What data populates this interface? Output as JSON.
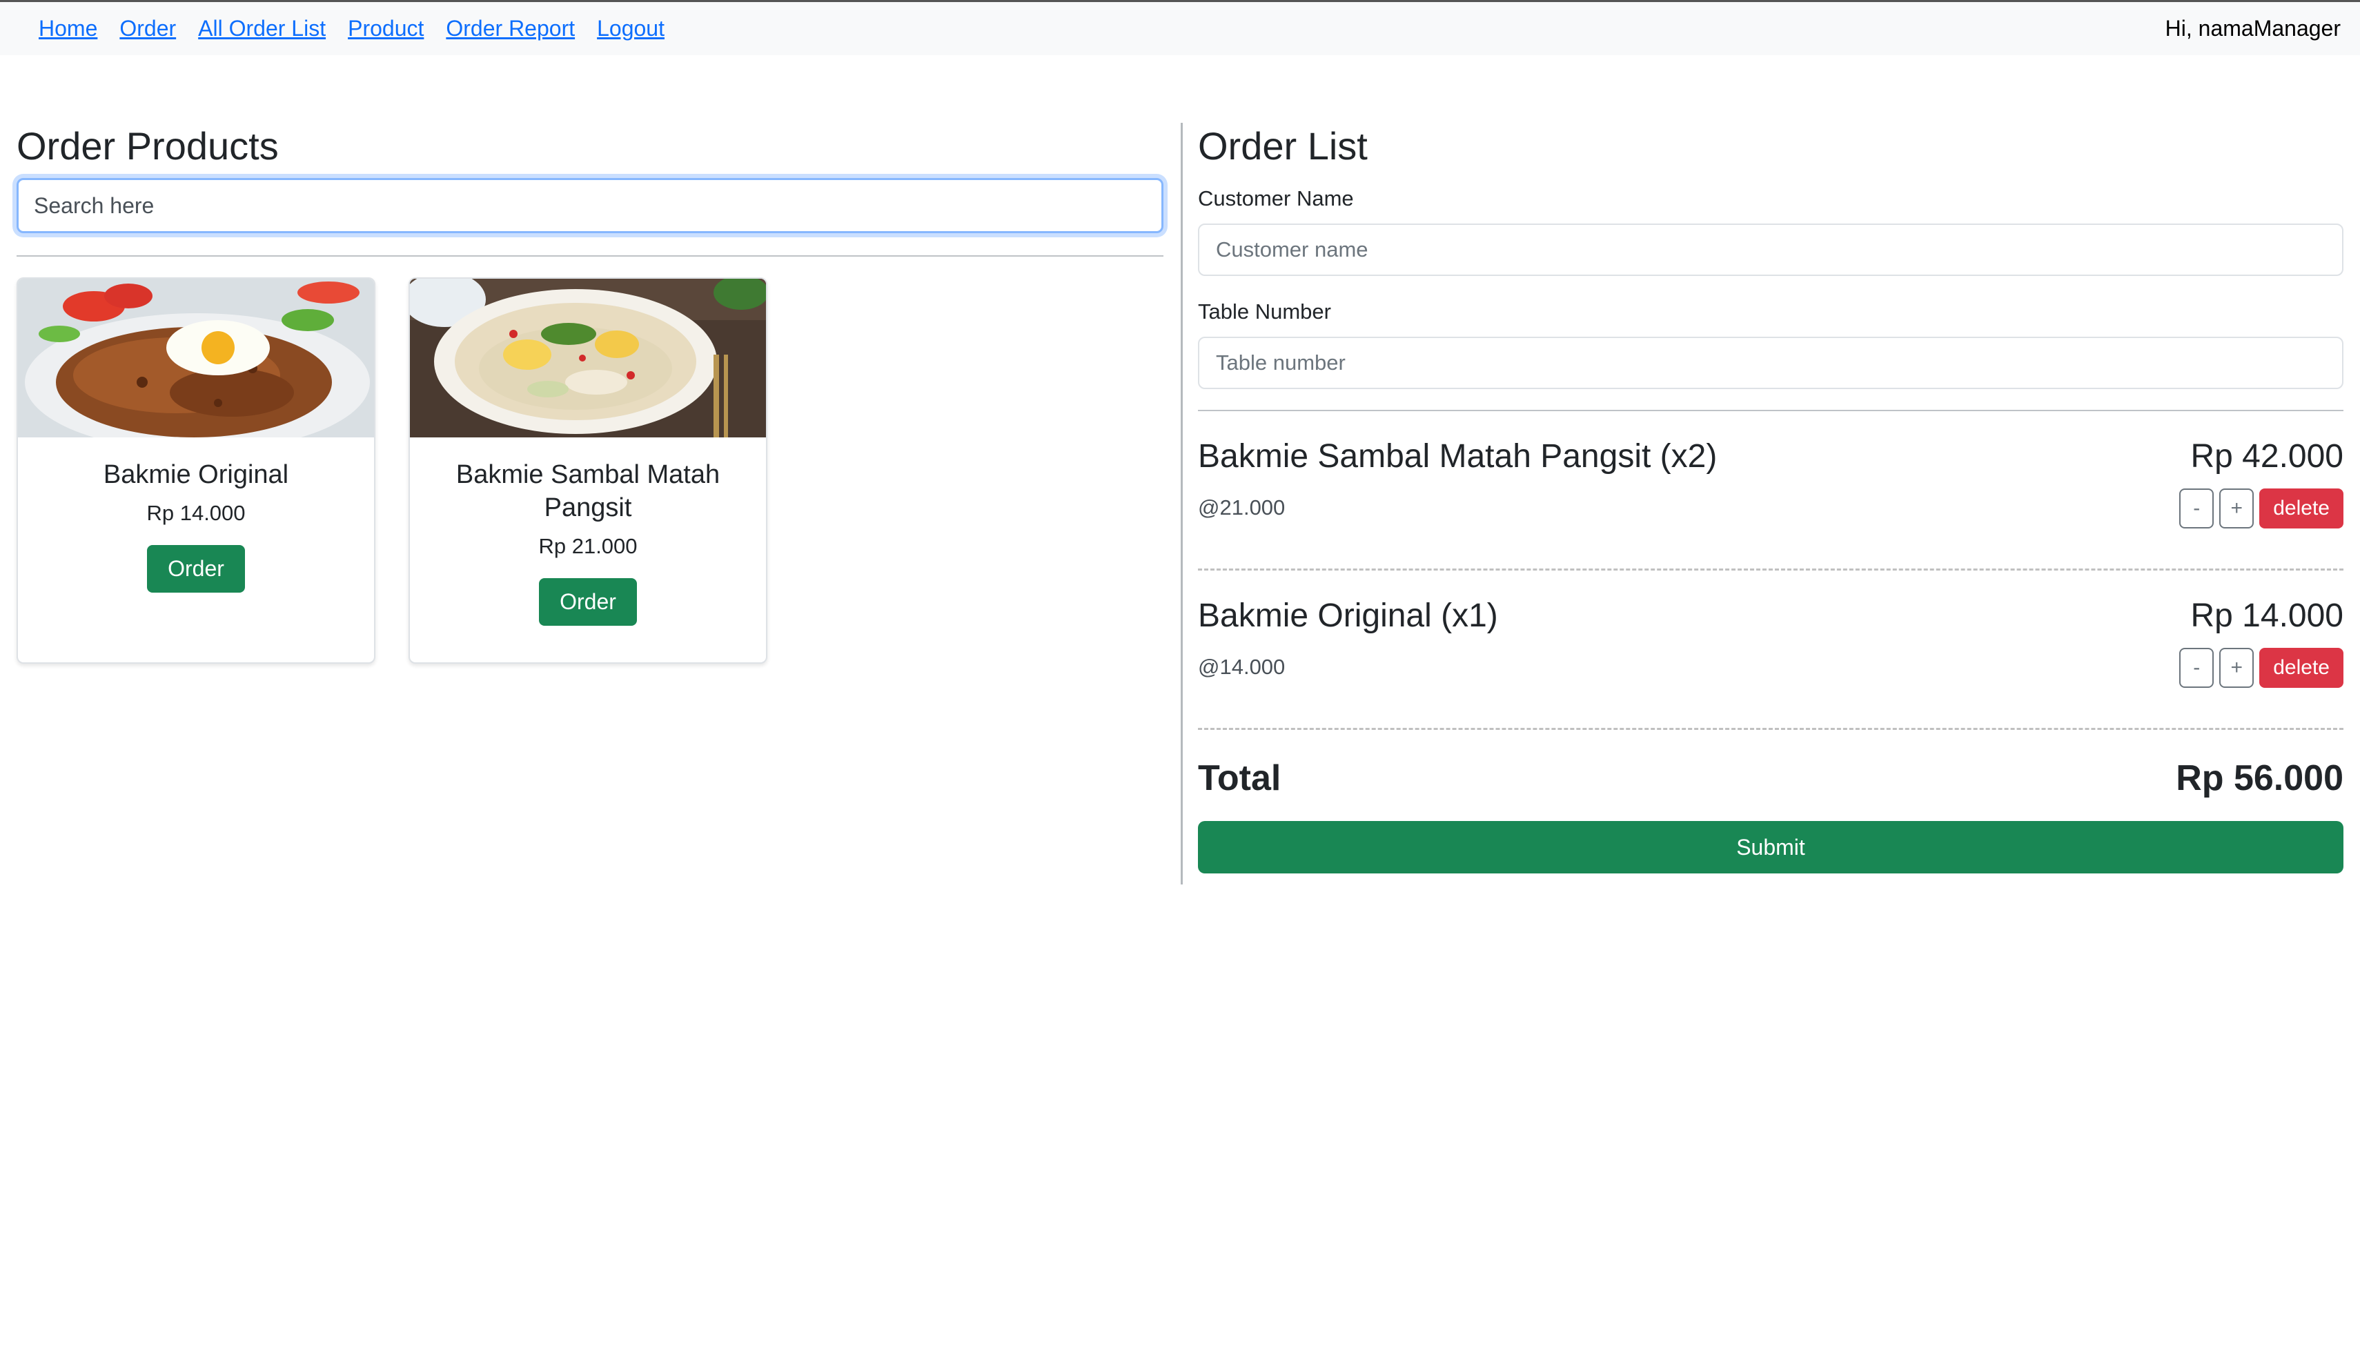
{
  "nav": {
    "links": [
      "Home",
      "Order",
      "All Order List",
      "Product",
      "Order Report",
      "Logout"
    ],
    "greeting": "Hi, namaManager"
  },
  "products_panel": {
    "title": "Order Products",
    "search_placeholder": "Search here",
    "products": [
      {
        "name": "Bakmie Original",
        "price": "Rp 14.000",
        "button": "Order"
      },
      {
        "name": "Bakmie Sambal Matah Pangsit",
        "price": "Rp 21.000",
        "button": "Order"
      }
    ]
  },
  "order_panel": {
    "title": "Order List",
    "customer_label": "Customer Name",
    "customer_placeholder": "Customer name",
    "table_label": "Table Number",
    "table_placeholder": "Table number",
    "items": [
      {
        "name": "Bakmie Sambal Matah Pangsit (x2)",
        "total": "Rp 42.000",
        "unit": "@21.000",
        "minus": "-",
        "plus": "+",
        "delete": "delete"
      },
      {
        "name": "Bakmie Original (x1)",
        "total": "Rp 14.000",
        "unit": "@14.000",
        "minus": "-",
        "plus": "+",
        "delete": "delete"
      }
    ],
    "total_label": "Total",
    "total_value": "Rp 56.000",
    "submit": "Submit"
  },
  "colors": {
    "link": "#0d6efd",
    "success": "#198754",
    "danger": "#dc3545",
    "focus_border": "#86b7fe"
  }
}
